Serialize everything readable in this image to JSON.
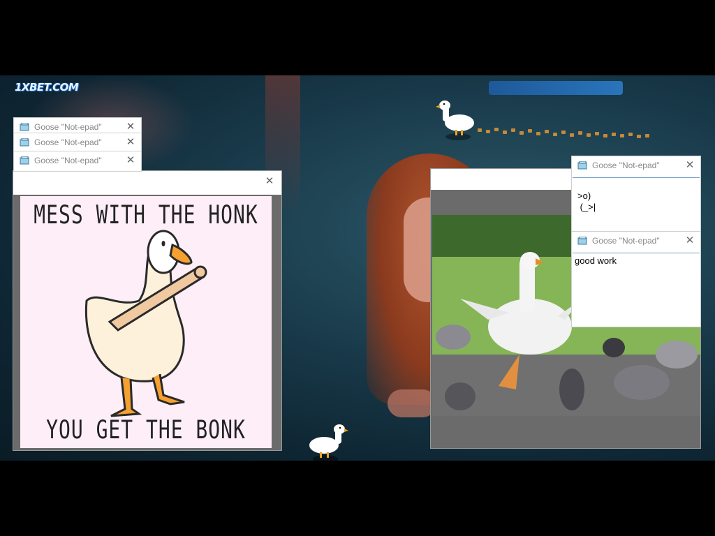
{
  "logo": {
    "text": "1XBET.COM"
  },
  "notepad": {
    "title": "Goose \"Not-epad\"",
    "windows": [
      {
        "title": "Goose \"Not-epad\"",
        "text": ""
      },
      {
        "title": "Goose \"Not-epad\"",
        "text": ""
      },
      {
        "title": "Goose \"Not-epad\"",
        "text": ""
      },
      {
        "title": "Goose \"Not-epad\"",
        "text": ">o)\n (_>|"
      },
      {
        "title": "Goose \"Not-epad\"",
        "text": "good work"
      }
    ]
  },
  "meme_window": {
    "top_text": "MESS WITH THE HONK",
    "bottom_text": "YOU GET THE BONK"
  },
  "close_symbol": "✕",
  "colors": {
    "goose_white": "#ffffff",
    "goose_orange": "#f0a020",
    "poster_bg": "#fdeef7",
    "mud_trail": "#c48a3a"
  }
}
